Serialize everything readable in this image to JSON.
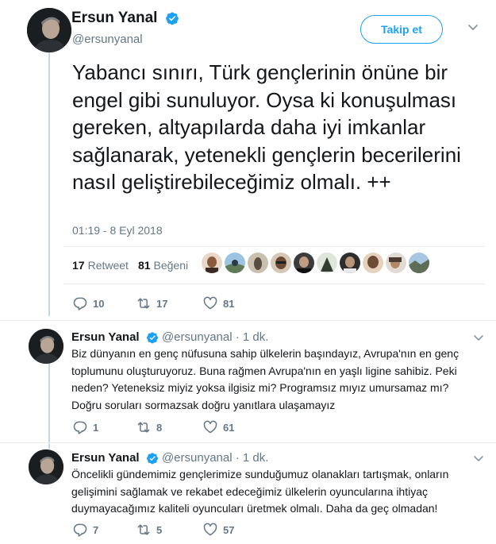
{
  "main_tweet": {
    "author_name": "Ersun Yanal",
    "handle": "@ersunyanal",
    "follow_label": "Takip et",
    "text": "Yabancı sınırı, Türk gençlerinin önüne bir engel gibi sunuluyor. Oysa ki konuşulması gereken, altyapılarda daha iyi imkanlar sağlanarak, yetenekli gençlerin becerilerini nasıl geliştirebileceğimiz olmalı. ++",
    "timestamp": "01:19 - 8 Eyl 2018",
    "retweet_count": "17",
    "retweet_label": "Retweet",
    "like_count": "81",
    "like_label": "Beğeni",
    "actions": {
      "reply": "10",
      "retweet": "17",
      "like": "81"
    }
  },
  "replies": [
    {
      "author_name": "Ersun Yanal",
      "handle": "@ersunyanal",
      "time": "· 1 dk.",
      "text": "Biz dünyanın en genç nüfusuna sahip ülkelerin başındayız, Avrupa'nın en genç toplumunu oluşturuyoruz. Buna rağmen Avrupa'nın en yaşlı ligine sahibiz. Peki neden? Yeteneksiz miyiz yoksa ilgisiz mi? Programsız mıyız umursamaz mı? Doğru soruları sormazsak doğru yanıtlara ulaşamayız",
      "actions": {
        "reply": "1",
        "retweet": "8",
        "like": "61"
      }
    },
    {
      "author_name": "Ersun Yanal",
      "handle": "@ersunyanal",
      "time": "· 1 dk.",
      "text": "Öncelikli gündemimiz gençlerimize sunduğumuz olanakları tartışmak, onların gelişimini sağlamak ve rekabet edeceğimiz ülkelerin oyuncularına ihtiyaç duymayacağımız kaliteli oyuncuları üretmek olmalı. Daha da geç olmadan!",
      "actions": {
        "reply": "7",
        "retweet": "5",
        "like": "57"
      }
    }
  ],
  "colors": {
    "accent": "#1da1f2",
    "text": "#14171a",
    "secondary": "#657786",
    "divider": "#e6ecf0"
  },
  "icons": [
    "verified-icon",
    "chevron-down-icon",
    "reply-icon",
    "retweet-icon",
    "heart-icon"
  ]
}
